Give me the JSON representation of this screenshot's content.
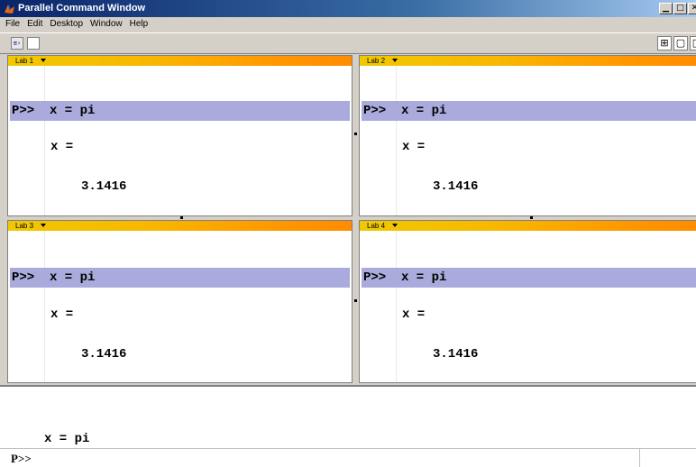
{
  "window": {
    "title": "Parallel Command Window",
    "controls": {
      "minimize": "▁",
      "maximize": "□",
      "close": "✕"
    }
  },
  "menu": {
    "items": [
      "File",
      "Edit",
      "Desktop",
      "Window",
      "Help"
    ]
  },
  "toolbar": {
    "left_icons": [
      "command-icon",
      "page-icon"
    ],
    "right_icons": [
      "grid-layout-icon",
      "window-layout-icon",
      "single-layout-icon"
    ],
    "cmd_glyph": "≡›",
    "grid_glyph": "⊞",
    "win_glyph": "▢",
    "single_glyph": "□"
  },
  "labs": [
    {
      "label": "Lab 1",
      "prompt": "P>>",
      "command": "x = pi",
      "output_var": "x =",
      "output_value": "3.1416"
    },
    {
      "label": "Lab 2",
      "prompt": "P>>",
      "command": "x = pi",
      "output_var": "x =",
      "output_value": "3.1416"
    },
    {
      "label": "Lab 3",
      "prompt": "P>>",
      "command": "x = pi",
      "output_var": "x =",
      "output_value": "3.1416"
    },
    {
      "label": "Lab 4",
      "prompt": "P>>",
      "command": "x = pi",
      "output_var": "x =",
      "output_value": "3.1416"
    }
  ],
  "history": {
    "last_command": "x = pi"
  },
  "command_line": {
    "prompt": "P>>",
    "value": ""
  },
  "colors": {
    "title_gradient_start": "#0a246a",
    "lab_header": "#f8b800",
    "command_highlight": "#aaaadc",
    "chrome": "#d4d0c8"
  }
}
